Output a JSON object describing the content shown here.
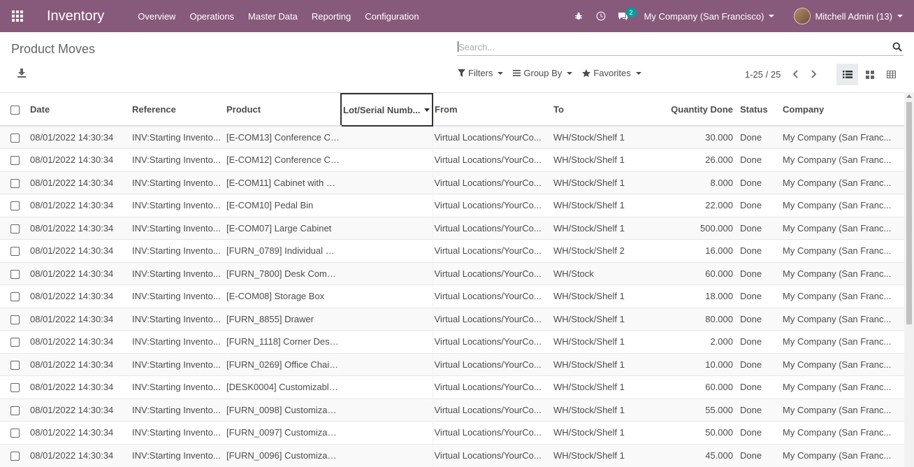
{
  "navbar": {
    "brand": "Inventory",
    "menu": [
      "Overview",
      "Operations",
      "Master Data",
      "Reporting",
      "Configuration"
    ],
    "messages_count": "2",
    "company": "My Company (San Francisco)",
    "user": "Mitchell Admin (13)"
  },
  "control_panel": {
    "title": "Product Moves",
    "search_placeholder": "Search...",
    "filters_label": "Filters",
    "group_by_label": "Group By",
    "favorites_label": "Favorites",
    "pager": "1-25 / 25",
    "active_view": "list"
  },
  "table": {
    "columns": [
      "Date",
      "Reference",
      "Product",
      "Lot/Serial Numb...",
      "From",
      "To",
      "Quantity Done",
      "Status",
      "Company"
    ],
    "rows": [
      {
        "date": "08/01/2022 14:30:34",
        "reference": "INV:Starting Invento...",
        "product": "[E-COM13] Conference Ch...",
        "lot": "",
        "from": "Virtual Locations/YourCo...",
        "to": "WH/Stock/Shelf 1",
        "qty": "30.000",
        "status": "Done",
        "company": "My Company (San Franc..."
      },
      {
        "date": "08/01/2022 14:30:34",
        "reference": "INV:Starting Invento...",
        "product": "[E-COM12] Conference Ch...",
        "lot": "",
        "from": "Virtual Locations/YourCo...",
        "to": "WH/Stock/Shelf 1",
        "qty": "26.000",
        "status": "Done",
        "company": "My Company (San Franc..."
      },
      {
        "date": "08/01/2022 14:30:34",
        "reference": "INV:Starting Invento...",
        "product": "[E-COM11] Cabinet with D...",
        "lot": "",
        "from": "Virtual Locations/YourCo...",
        "to": "WH/Stock/Shelf 1",
        "qty": "8.000",
        "status": "Done",
        "company": "My Company (San Franc..."
      },
      {
        "date": "08/01/2022 14:30:34",
        "reference": "INV:Starting Invento...",
        "product": "[E-COM10] Pedal Bin",
        "lot": "",
        "from": "Virtual Locations/YourCo...",
        "to": "WH/Stock/Shelf 1",
        "qty": "22.000",
        "status": "Done",
        "company": "My Company (San Franc..."
      },
      {
        "date": "08/01/2022 14:30:34",
        "reference": "INV:Starting Invento...",
        "product": "[E-COM07] Large Cabinet",
        "lot": "",
        "from": "Virtual Locations/YourCo...",
        "to": "WH/Stock/Shelf 1",
        "qty": "500.000",
        "status": "Done",
        "company": "My Company (San Franc..."
      },
      {
        "date": "08/01/2022 14:30:34",
        "reference": "INV:Starting Invento...",
        "product": "[FURN_0789] Individual W...",
        "lot": "",
        "from": "Virtual Locations/YourCo...",
        "to": "WH/Stock/Shelf 2",
        "qty": "16.000",
        "status": "Done",
        "company": "My Company (San Franc..."
      },
      {
        "date": "08/01/2022 14:30:34",
        "reference": "INV:Starting Invento...",
        "product": "[FURN_7800] Desk Combi...",
        "lot": "",
        "from": "Virtual Locations/YourCo...",
        "to": "WH/Stock",
        "qty": "60.000",
        "status": "Done",
        "company": "My Company (San Franc..."
      },
      {
        "date": "08/01/2022 14:30:34",
        "reference": "INV:Starting Invento...",
        "product": "[E-COM08] Storage Box",
        "lot": "",
        "from": "Virtual Locations/YourCo...",
        "to": "WH/Stock/Shelf 1",
        "qty": "18.000",
        "status": "Done",
        "company": "My Company (San Franc..."
      },
      {
        "date": "08/01/2022 14:30:34",
        "reference": "INV:Starting Invento...",
        "product": "[FURN_8855] Drawer",
        "lot": "",
        "from": "Virtual Locations/YourCo...",
        "to": "WH/Stock/Shelf 1",
        "qty": "80.000",
        "status": "Done",
        "company": "My Company (San Franc..."
      },
      {
        "date": "08/01/2022 14:30:34",
        "reference": "INV:Starting Invento...",
        "product": "[FURN_1118] Corner Desk ...",
        "lot": "",
        "from": "Virtual Locations/YourCo...",
        "to": "WH/Stock/Shelf 1",
        "qty": "2.000",
        "status": "Done",
        "company": "My Company (San Franc..."
      },
      {
        "date": "08/01/2022 14:30:34",
        "reference": "INV:Starting Invento...",
        "product": "[FURN_0269] Office Chair ...",
        "lot": "",
        "from": "Virtual Locations/YourCo...",
        "to": "WH/Stock/Shelf 1",
        "qty": "10.000",
        "status": "Done",
        "company": "My Company (San Franc..."
      },
      {
        "date": "08/01/2022 14:30:34",
        "reference": "INV:Starting Invento...",
        "product": "[DESK0004] Customizable...",
        "lot": "",
        "from": "Virtual Locations/YourCo...",
        "to": "WH/Stock/Shelf 1",
        "qty": "60.000",
        "status": "Done",
        "company": "My Company (San Franc..."
      },
      {
        "date": "08/01/2022 14:30:34",
        "reference": "INV:Starting Invento...",
        "product": "[FURN_0098] Customizabl...",
        "lot": "",
        "from": "Virtual Locations/YourCo...",
        "to": "WH/Stock/Shelf 1",
        "qty": "55.000",
        "status": "Done",
        "company": "My Company (San Franc..."
      },
      {
        "date": "08/01/2022 14:30:34",
        "reference": "INV:Starting Invento...",
        "product": "[FURN_0097] Customizabl...",
        "lot": "",
        "from": "Virtual Locations/YourCo...",
        "to": "WH/Stock/Shelf 1",
        "qty": "50.000",
        "status": "Done",
        "company": "My Company (San Franc..."
      },
      {
        "date": "08/01/2022 14:30:34",
        "reference": "INV:Starting Invento...",
        "product": "[FURN_0096] Customizabl...",
        "lot": "",
        "from": "Virtual Locations/YourCo...",
        "to": "WH/Stock/Shelf 1",
        "qty": "45.000",
        "status": "Done",
        "company": "My Company (San Franc..."
      }
    ]
  },
  "colors": {
    "navbar": "#875a7b",
    "badge": "#00a09d"
  },
  "icons": [
    "apps-icon",
    "bug-icon",
    "clock-icon",
    "chat-icon",
    "search-icon",
    "download-icon",
    "filter-icon",
    "group-by-icon",
    "star-icon",
    "chevron-left-icon",
    "chevron-right-icon",
    "list-view-icon",
    "kanban-view-icon",
    "pivot-view-icon"
  ]
}
